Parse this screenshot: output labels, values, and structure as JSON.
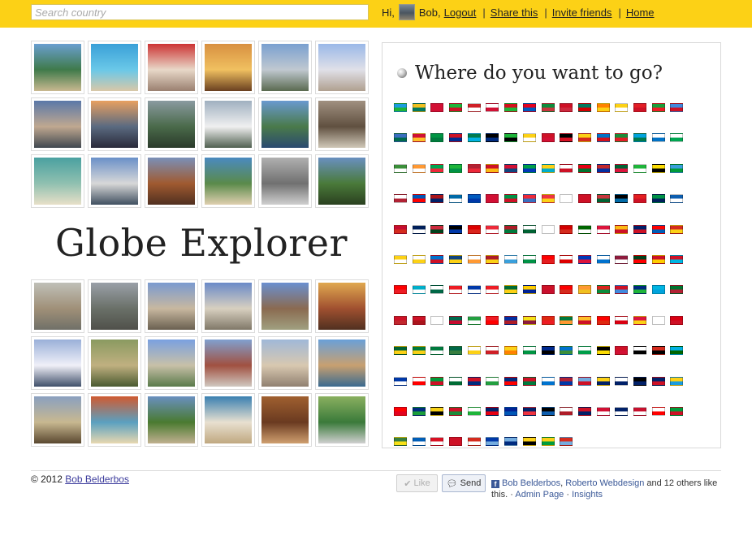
{
  "topbar": {
    "search_placeholder": "Search country",
    "greeting": "Hi,",
    "user_name": "Bob,",
    "links": {
      "logout": "Logout",
      "share": "Share this",
      "invite": "Invite friends",
      "home": "Home"
    },
    "separator": "|",
    "bar_color": "#fcd116"
  },
  "brand": {
    "title": "Globe Explorer"
  },
  "photos_top": [
    "palm beach resort",
    "crowded pool",
    "storefront",
    "sunset boat",
    "lakeside town",
    "mosque",
    "tower block",
    "sea sunset",
    "green mountains",
    "modern villa",
    "coastal cliffs",
    "old crowd photo",
    "tropical beach",
    "modern building",
    "stone tower",
    "beach cove",
    "old town square",
    "forest valley"
  ],
  "photos_bottom": [
    "grey beach",
    "sea horizon",
    "coastal houses",
    "classical facade",
    "hill castle",
    "autumn street",
    "snowy mountains",
    "savanna trees",
    "domed building",
    "coastal city",
    "desert road",
    "sailboat harbor",
    "thatched hut",
    "market umbrellas",
    "tropical tree",
    "surf beach",
    "wood carving",
    "green building"
  ],
  "panel": {
    "title": "Where do you want to go?",
    "globe_icon": "globe-icon"
  },
  "flags": [
    "#1a9de0",
    "#f0c020",
    "#d21034",
    "#1eb53a",
    "#cf2027",
    "#ffffff",
    "#d4101c",
    "#e3021f",
    "#0c8c3c",
    "#ce1126",
    "#007a5e",
    "#ff8200",
    "#fcd116",
    "#e21e26",
    "#1a9e3a",
    "#4189dd",
    "#3a6fc0",
    "#d21034",
    "#009543",
    "#ce1126",
    "#007a4d",
    "#000000",
    "#1eb53a",
    "#fcd116",
    "#ce1126",
    "#000000",
    "#fcd116",
    "#0072c6",
    "#1c8c3a",
    "#00a3dd",
    "#ffffff",
    "#ffffff",
    "#3b8f3a",
    "#ff9933",
    "#00a651",
    "#1eb53a",
    "#b22234",
    "#ce1126",
    "#d21034",
    "#009e49",
    "#fcd116",
    "#ffffff",
    "#e70013",
    "#c1272d",
    "#006233",
    "#1eb53a",
    "#fcdc04",
    "#3aa0dc",
    "#ffffff",
    "#0057b7",
    "#aa151b",
    "#006aa7",
    "#005bbf",
    "#d21034",
    "#009246",
    "#ed2939",
    "#ef3340",
    "#ffffff",
    "#ce1126",
    "#c6363c",
    "#000000",
    "#e41e20",
    "#009246",
    "#0d5eaf",
    "#c60c30",
    "#00205b",
    "#cd2a3e",
    "#000000",
    "#dd0000",
    "#ed2939",
    "#ae1c28",
    "#ffffff",
    "#ffffff",
    "#d20000",
    "#006600",
    "#dc143c",
    "#fdb913",
    "#012169",
    "#ff0000",
    "#d52b1e",
    "#fcd116",
    "#ffffff",
    "#0072ce",
    "#11457e",
    "#ffffff",
    "#ae1c28",
    "#ffffff",
    "#ffffff",
    "#ff0000",
    "#ffffff",
    "#0038b8",
    "#ffffff",
    "#8d1b3d",
    "#01411c",
    "#ce1126",
    "#ce1126",
    "#ff0000",
    "#00afca",
    "#ffffff",
    "#ed1c24",
    "#0038a8",
    "#ee1c25",
    "#006c35",
    "#ffcd00",
    "#ce1126",
    "#fe0000",
    "#ff9933",
    "#da251d",
    "#ce1126",
    "#002b7f",
    "#00b5e2",
    "#00732f",
    "#ce1126",
    "#ce1126",
    "#ffffff",
    "#006a4e",
    "#239f40",
    "#ee1c25",
    "#032ea1",
    "#f7e017",
    "#de2910",
    "#007a3d",
    "#ffbe29",
    "#ff0000",
    "#ffffff",
    "#dc143c",
    "#ffffff",
    "#d90012",
    "#006233",
    "#007a3d",
    "#007a3d",
    "#006847",
    "#ffffff",
    "#ffffff",
    "#fcd116",
    "#ffffff",
    "#002a8f",
    "#0073cf",
    "#ffffff",
    "#000000",
    "#ce1126",
    "#ffffff",
    "#d52b1e",
    "#00b2e3",
    "#0038a8",
    "#ffffff",
    "#009b3a",
    "#ffffff",
    "#ce1126",
    "#ffffff",
    "#002b7f",
    "#ce1126",
    "#ffffff",
    "#b22234",
    "#74acdf",
    "#fcd116",
    "#ffffff",
    "#000000",
    "#012169",
    "#fcd116",
    "#fe0000",
    "#002b7f",
    "#f7d116",
    "#ce1126",
    "#ffffff",
    "#012169",
    "#002395",
    "#012169",
    "#000000",
    "#ffffff",
    "#ce1126",
    "#d21034",
    "#012169",
    "#c8102e",
    "#ffffff",
    "#009c3b",
    "#377e3f",
    "#005eb8",
    "#d91023",
    "#ce1126",
    "#d52b1e",
    "#0038a8",
    "#74acdf",
    "#fcd116",
    "#fcd116",
    "#d52b1e"
  ],
  "footer": {
    "copyright": "© 2012",
    "author_link": "Bob Belderbos",
    "like_label": "Like",
    "send_label": "Send",
    "fb_friend1": "Bob Belderbos",
    "fb_sep": ",",
    "fb_friend2": "Roberto Webdesign",
    "fb_rest": "and 12 others like this.",
    "fb_dot": "·",
    "admin_link": "Admin Page",
    "insights_link": "Insights"
  }
}
